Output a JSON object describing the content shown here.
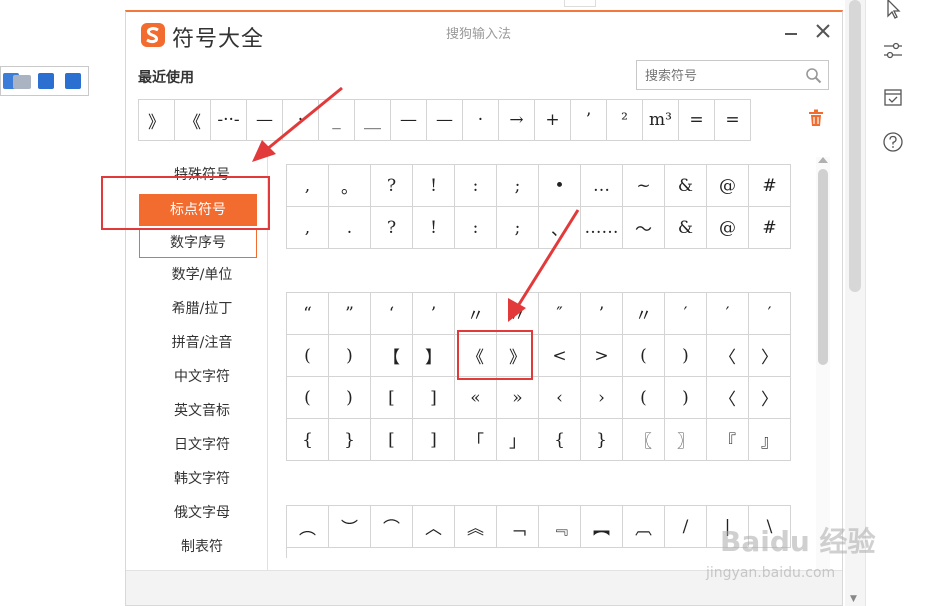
{
  "window": {
    "title": "符号大全",
    "ime_name": "搜狗输入法",
    "minimize_icon": "minimize-icon",
    "close_icon": "close-icon"
  },
  "recent": {
    "label": "最近使用",
    "symbols": [
      "》",
      "《",
      "-··-",
      "—",
      "·",
      "_",
      "__",
      "—",
      "—",
      "·",
      "→",
      "+",
      "’",
      "²",
      "m³",
      "=",
      "="
    ]
  },
  "search": {
    "placeholder": "搜索符号"
  },
  "categories": [
    {
      "label": "特殊符号"
    },
    {
      "label": "标点符号"
    },
    {
      "label": "数字序号"
    },
    {
      "label": "数学/单位"
    },
    {
      "label": "希腊/拉丁"
    },
    {
      "label": "拼音/注音"
    },
    {
      "label": "中文字符"
    },
    {
      "label": "英文音标"
    },
    {
      "label": "日文字符"
    },
    {
      "label": "韩文字符"
    },
    {
      "label": "俄文字母"
    },
    {
      "label": "制表符"
    }
  ],
  "active_category": "标点符号",
  "grid1": [
    ",",
    "。",
    "?",
    "!",
    ":",
    ";",
    "•",
    "…",
    "~",
    "&",
    "@",
    "#",
    ",",
    ".",
    "?",
    "!",
    ":",
    ";",
    "、",
    "……",
    "～",
    "&",
    "@",
    "#"
  ],
  "grid2": [
    "“",
    "”",
    "‘",
    "’",
    "〃",
    "〃",
    "″",
    "’",
    "〃",
    "′",
    "′",
    "′",
    "(",
    ")",
    "【",
    "】",
    "《",
    "》",
    "<",
    ">",
    "(",
    ")",
    "〈",
    "〉",
    "(",
    ")",
    "[",
    "]",
    "«",
    "»",
    "‹",
    "›",
    "(",
    ")",
    "〈",
    "〉",
    "{",
    "}",
    "[",
    "]",
    "「",
    "」",
    "{",
    "}",
    "〖",
    "〗",
    "『",
    "』"
  ],
  "grid3": [
    "︵",
    "︶",
    "⌒",
    "︿",
    "︽",
    "﹁",
    "﹃",
    "︻",
    "︹",
    "/",
    "|",
    "\\"
  ],
  "watermark": {
    "main": "Baidu 经验",
    "sub": "jingyan.baidu.com"
  }
}
